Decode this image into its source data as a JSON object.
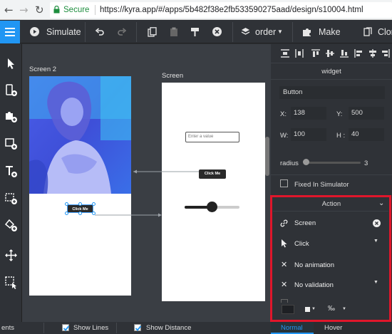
{
  "browser": {
    "secure_label": "Secure",
    "url": "https://kyra.app/#/apps/5b482f38e2fb533590275aad/design/s10004.html"
  },
  "toolbar": {
    "simulate_label": "Simulate",
    "order_label": "order",
    "make_icon_label": "Make icon",
    "clone_label": "Clon"
  },
  "canvas": {
    "screen2_label": "Screen 2",
    "screen1_label": "Screen",
    "button_label": "Click Me",
    "input_placeholder": "Enter a value"
  },
  "bottom": {
    "events_label": "ents",
    "show_lines_label": "Show Lines",
    "show_distance_label": "Show Distance"
  },
  "panel": {
    "widget_label": "widget",
    "name_value": "Button",
    "x_label": "X:",
    "x_value": "138",
    "y_label": "Y:",
    "y_value": "500",
    "w_label": "W:",
    "w_value": "100",
    "h_label": "H :",
    "h_value": "40",
    "radius_label": "radius",
    "radius_value": "3",
    "fixed_label": "Fixed In Simulator",
    "action_header": "Action",
    "action_target": "Screen",
    "action_event": "Click",
    "action_animation": "No animation",
    "action_validation": "No validation",
    "tab_normal": "Normal",
    "tab_hover": "Hover"
  },
  "colors": {
    "accent": "#2196f3",
    "highlight_border": "#e0162b",
    "secure_green": "#1e8e3e"
  }
}
